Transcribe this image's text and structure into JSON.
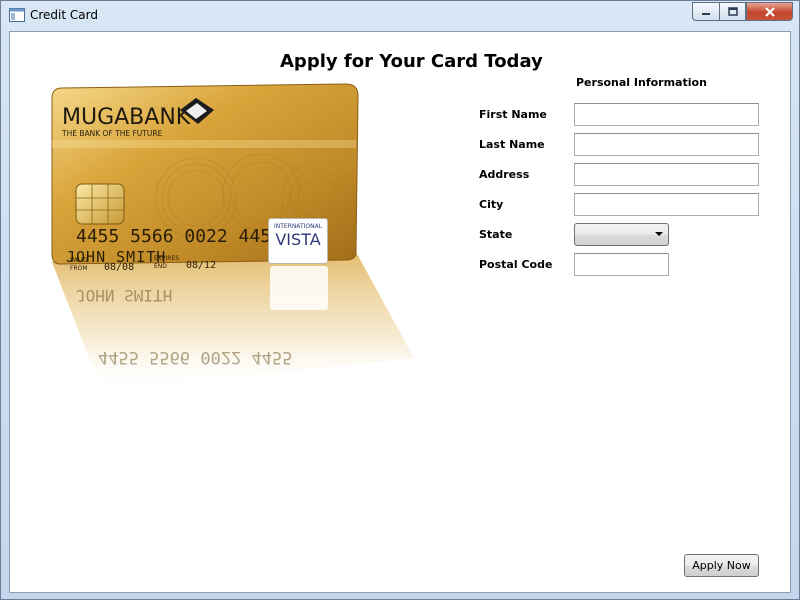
{
  "window": {
    "title": "Credit Card",
    "icons": {
      "app": "window-app-icon",
      "minimize": "minimize-icon",
      "maximize": "maximize-icon",
      "close": "close-icon"
    }
  },
  "main": {
    "heading": "Apply for Your Card Today",
    "section_title": "Personal Information",
    "fields": {
      "first_name": {
        "label": "First Name",
        "value": ""
      },
      "last_name": {
        "label": "Last Name",
        "value": ""
      },
      "address": {
        "label": "Address",
        "value": ""
      },
      "city": {
        "label": "City",
        "value": ""
      },
      "state": {
        "label": "State",
        "value": ""
      },
      "postal_code": {
        "label": "Postal Code",
        "value": ""
      }
    },
    "apply_button": "Apply Now"
  },
  "card": {
    "bank_name": "MUGABANK",
    "tagline": "THE BANK OF THE FUTURE",
    "number": "4455  5566  0022  4455",
    "valid_from_label_1": "VALID",
    "valid_from_label_2": "FROM",
    "valid_from": "08/08",
    "expires_label_1": "EXPIRES",
    "expires_label_2": "END",
    "expires": "08/12",
    "holder": "JOHN SMITH",
    "network_top": "INTERNATIONAL",
    "network": "VISTA",
    "colors": {
      "gold_light": "#f3d27a",
      "gold": "#d9a43a",
      "gold_dark": "#9c6a18"
    }
  }
}
